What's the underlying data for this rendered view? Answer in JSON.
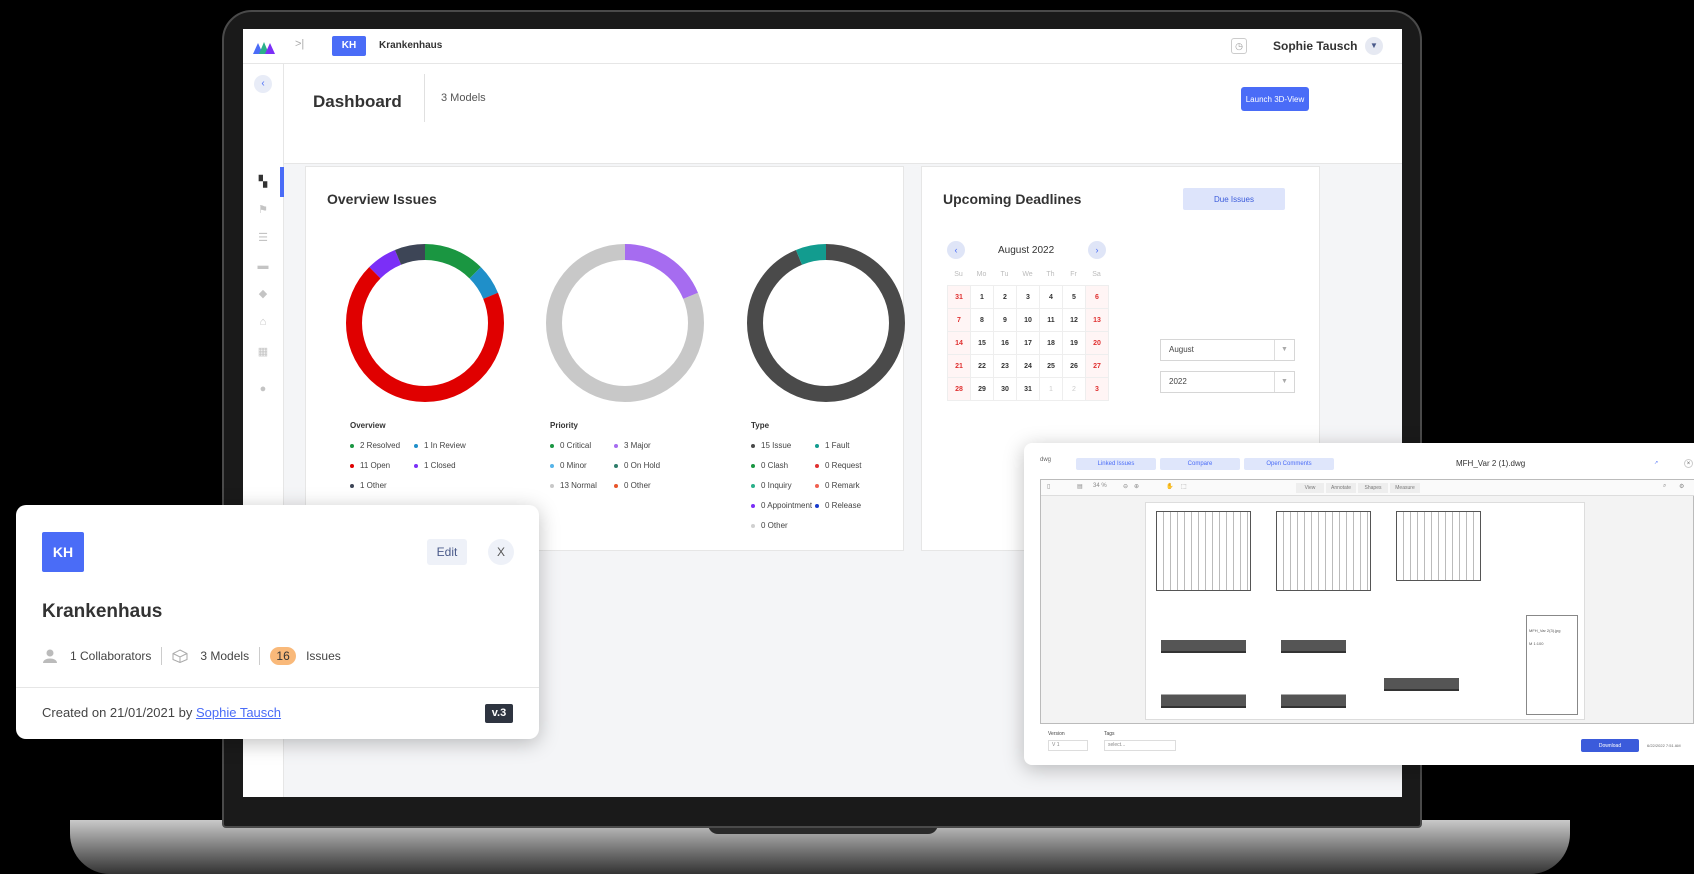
{
  "app": {
    "project_badge": "KH",
    "project_name": "Krankenhaus",
    "user_name": "Sophie Tausch"
  },
  "header": {
    "title": "Dashboard",
    "models": "3 Models",
    "launch_label": "Launch 3D-View"
  },
  "overview": {
    "title": "Overview Issues",
    "charts": [
      {
        "legend_title": "Overview",
        "items": [
          {
            "label": "2 Resolved",
            "value": 2,
            "color": "#1a9641"
          },
          {
            "label": "1 In Review",
            "value": 1,
            "color": "#1f8fc9"
          },
          {
            "label": "11 Open",
            "value": 11,
            "color": "#e00000"
          },
          {
            "label": "1 Closed",
            "value": 1,
            "color": "#7b2ff7"
          },
          {
            "label": "1 Other",
            "value": 1,
            "color": "#3d4556"
          }
        ]
      },
      {
        "legend_title": "Priority",
        "items": [
          {
            "label": "0 Critical",
            "value": 0,
            "color": "#1a9641"
          },
          {
            "label": "3 Major",
            "value": 3,
            "color": "#a66cf0"
          },
          {
            "label": "0 Minor",
            "value": 0,
            "color": "#56b4e9"
          },
          {
            "label": "0 On Hold",
            "value": 0,
            "color": "#2e7d6a"
          },
          {
            "label": "13 Normal",
            "value": 13,
            "color": "#c8c8c8"
          },
          {
            "label": "0 Other",
            "value": 0,
            "color": "#e8552a"
          }
        ]
      },
      {
        "legend_title": "Type",
        "items": [
          {
            "label": "15 Issue",
            "value": 15,
            "color": "#4a4a4a"
          },
          {
            "label": "1 Fault",
            "value": 1,
            "color": "#129c8f"
          },
          {
            "label": "0 Clash",
            "value": 0,
            "color": "#1a9641"
          },
          {
            "label": "0 Request",
            "value": 0,
            "color": "#e03131"
          },
          {
            "label": "0 Inquiry",
            "value": 0,
            "color": "#2bb08a"
          },
          {
            "label": "0 Remark",
            "value": 0,
            "color": "#f06050"
          },
          {
            "label": "0 Appointment",
            "value": 0,
            "color": "#7b2ff7"
          },
          {
            "label": "0 Release",
            "value": 0,
            "color": "#1a3ccc"
          },
          {
            "label": "0 Other",
            "value": 0,
            "color": "#d0d0d0"
          }
        ]
      }
    ]
  },
  "deadlines": {
    "title": "Upcoming Deadlines",
    "due_label": "Due Issues",
    "month_label": "August 2022",
    "weekdays": [
      "Su",
      "Mo",
      "Tu",
      "We",
      "Th",
      "Fr",
      "Sa"
    ],
    "days": [
      "31",
      "1",
      "2",
      "3",
      "4",
      "5",
      "6",
      "7",
      "8",
      "9",
      "10",
      "11",
      "12",
      "13",
      "14",
      "15",
      "16",
      "17",
      "18",
      "19",
      "20",
      "21",
      "22",
      "23",
      "24",
      "25",
      "26",
      "27",
      "28",
      "29",
      "30",
      "31",
      "1",
      "2",
      "3"
    ],
    "month_select": "August",
    "year_select": "2022"
  },
  "project_card": {
    "badge": "KH",
    "edit_label": "Edit",
    "close_label": "X",
    "name": "Krankenhaus",
    "collaborators": "1 Collaborators",
    "models": "3 Models",
    "issues_count": "16",
    "issues_label": "Issues",
    "created_prefix": "Created on 21/01/2021 by",
    "created_by": "Sophie Tausch",
    "version": "v.3"
  },
  "viewer": {
    "file_type": "dwg",
    "linked_issues": "Linked Issues",
    "compare": "Compare",
    "open_comments": "Open Comments",
    "file_name": "MFH_Var 2 (1).dwg",
    "zoom": "34 %",
    "tabs": [
      "View",
      "Annotate",
      "Shapes",
      "Measure"
    ],
    "titleblock_text": "MFH_Var 2(3).jpg",
    "scale_text": "M 1:100",
    "version_label": "Version",
    "version_value": "V 1",
    "tags_label": "Tags",
    "tags_placeholder": "select...",
    "download_label": "Download",
    "date": "6/22/2022 7:51 AM"
  }
}
